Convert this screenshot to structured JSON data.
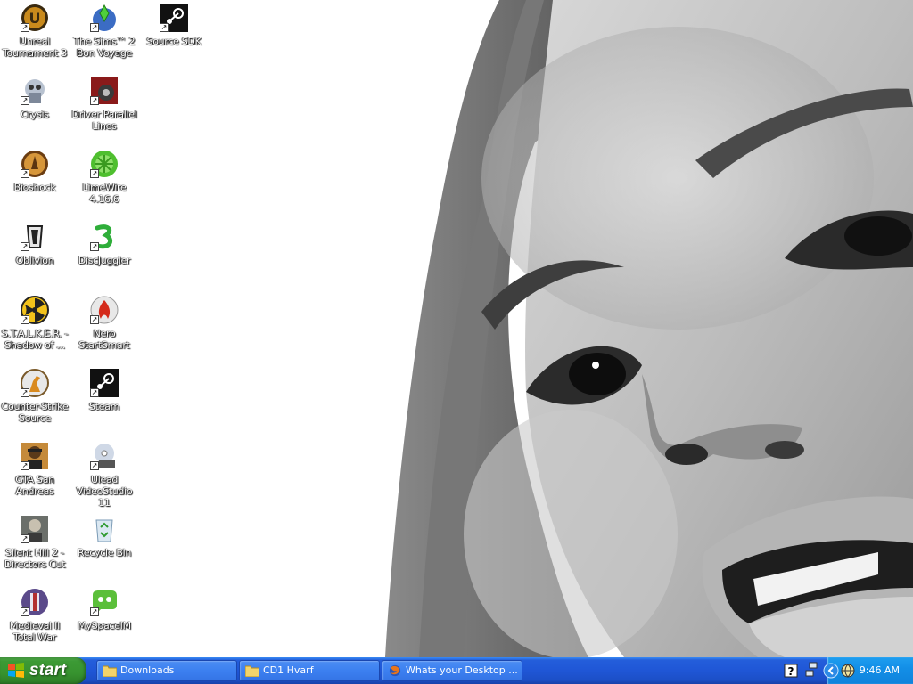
{
  "desktop": {
    "icons": [
      {
        "label": "Unreal Tournament 3",
        "icon": "unreal-tournament-icon"
      },
      {
        "label": "The Sims™ 2 Bon Voyage",
        "icon": "sims-icon"
      },
      {
        "label": "Source SDK",
        "icon": "steam-icon"
      },
      {
        "label": "Crysis",
        "icon": "crysis-icon"
      },
      {
        "label": "Driver Parallel Lines",
        "icon": "driver-icon"
      },
      {
        "label": "Bioshock",
        "icon": "bioshock-icon"
      },
      {
        "label": "LimeWire 4.16.6",
        "icon": "limewire-icon"
      },
      {
        "label": "Oblivion",
        "icon": "oblivion-icon"
      },
      {
        "label": "DiscJuggler",
        "icon": "discjuggler-icon"
      },
      {
        "label": "S.T.A.L.K.E.R. - Shadow of ...",
        "icon": "stalker-icon"
      },
      {
        "label": "Nero StartSmart",
        "icon": "nero-icon"
      },
      {
        "label": "Counter-Strike Source",
        "icon": "counter-strike-icon"
      },
      {
        "label": "Steam",
        "icon": "steam-icon"
      },
      {
        "label": "GTA San Andreas",
        "icon": "gta-icon"
      },
      {
        "label": "Ulead VideoStudio 11",
        "icon": "ulead-icon"
      },
      {
        "label": "Silent Hill 2 - Directors Cut",
        "icon": "silent-hill-icon"
      },
      {
        "label": "Recycle Bin",
        "icon": "recycle-bin-icon"
      },
      {
        "label": "Medieval II Total War",
        "icon": "medieval-icon"
      },
      {
        "label": "MySpaceIM",
        "icon": "myspaceim-icon"
      }
    ]
  },
  "taskbar": {
    "start_label": "start",
    "tasks": [
      {
        "label": "Downloads",
        "icon": "folder-icon"
      },
      {
        "label": "CD1 Hvarf",
        "icon": "folder-icon"
      },
      {
        "label": "Whats your Desktop ...",
        "icon": "firefox-icon"
      }
    ],
    "tray": {
      "clock": "9:46 AM",
      "icons": [
        "help-icon",
        "network-icon",
        "show-hidden-icon",
        "globe-icon"
      ]
    }
  },
  "colors": {
    "taskbar_blue": "#245edb",
    "start_green": "#3c9a35",
    "tray_blue": "#138fe7"
  }
}
